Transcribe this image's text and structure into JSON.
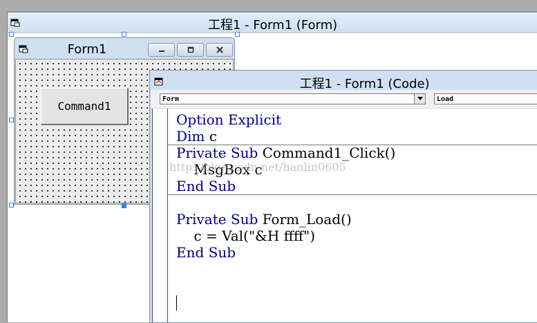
{
  "designer": {
    "title": "工程1 - Form1 (Form)"
  },
  "form": {
    "title": "Form1",
    "command_button_label": "Command1"
  },
  "code_window": {
    "title": "工程1 - Form1 (Code)",
    "object_combo": "Form",
    "procedure_combo": "Load",
    "lines": [
      [
        {
          "t": "Option Explicit",
          "kw": true
        }
      ],
      [
        {
          "t": "Dim",
          "kw": true
        },
        {
          "t": " c",
          "kw": false
        }
      ],
      [
        {
          "t": "Private Sub",
          "kw": true
        },
        {
          "t": " Command1_Click()",
          "kw": false
        }
      ],
      [
        {
          "t": "    MsgBox c",
          "kw": false
        }
      ],
      [
        {
          "t": "End Sub",
          "kw": true
        }
      ],
      [
        {
          "t": "",
          "kw": false
        }
      ],
      [
        {
          "t": "Private Sub",
          "kw": true
        },
        {
          "t": " Form_Load()",
          "kw": false
        }
      ],
      [
        {
          "t": "    c = Val(\"&H ffff\")",
          "kw": false
        }
      ],
      [
        {
          "t": "End Sub",
          "kw": true
        }
      ]
    ]
  },
  "watermark": "http://blog.csdn.net/hanlin0605",
  "colors": {
    "keyword": "#000080",
    "titlebar": "#cfe0f3"
  }
}
